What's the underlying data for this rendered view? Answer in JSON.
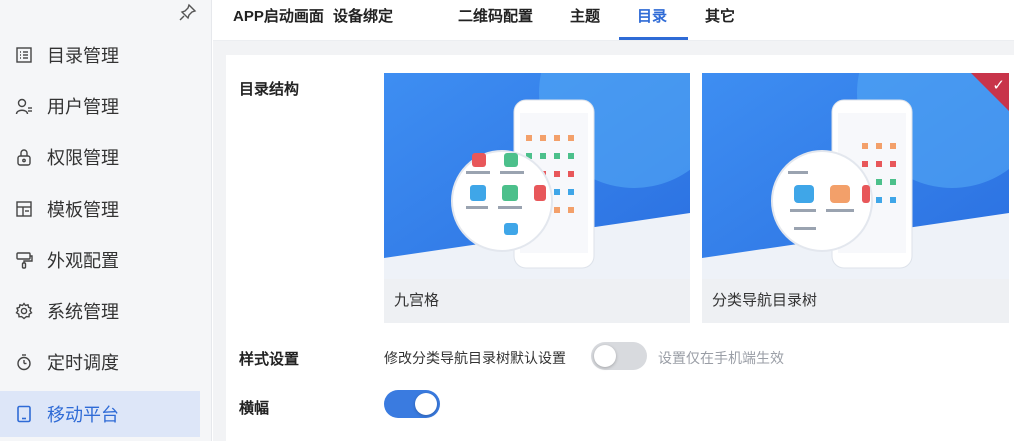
{
  "sidebar": {
    "items": [
      {
        "label": "目录管理",
        "icon": "list-icon"
      },
      {
        "label": "用户管理",
        "icon": "user-icon"
      },
      {
        "label": "权限管理",
        "icon": "lock-icon"
      },
      {
        "label": "模板管理",
        "icon": "template-icon"
      },
      {
        "label": "外观配置",
        "icon": "brush-icon"
      },
      {
        "label": "系统管理",
        "icon": "gear-icon"
      },
      {
        "label": "定时调度",
        "icon": "timer-icon"
      },
      {
        "label": "移动平台",
        "icon": "tablet-icon",
        "active": true
      }
    ]
  },
  "tabs": [
    {
      "label": "APP启动画面"
    },
    {
      "label": "设备绑定"
    },
    {
      "label": "二维码配置"
    },
    {
      "label": "主题"
    },
    {
      "label": "目录",
      "active": true
    },
    {
      "label": "其它"
    }
  ],
  "main": {
    "directory_structure_label": "目录结构",
    "options": [
      {
        "caption": "九宫格",
        "selected": false
      },
      {
        "caption": "分类导航目录树",
        "selected": true
      }
    ],
    "style_label": "样式设置",
    "style_desc": "修改分类导航目录树默认设置",
    "style_toggle_on": false,
    "style_hint": "设置仅在手机端生效",
    "banner_label": "横幅",
    "banner_toggle_on": true
  },
  "colors": {
    "accent": "#2f6bd6",
    "selected_mark": "#c8344a",
    "toggle_on": "#3a7be0",
    "toggle_off": "#d8dade"
  }
}
